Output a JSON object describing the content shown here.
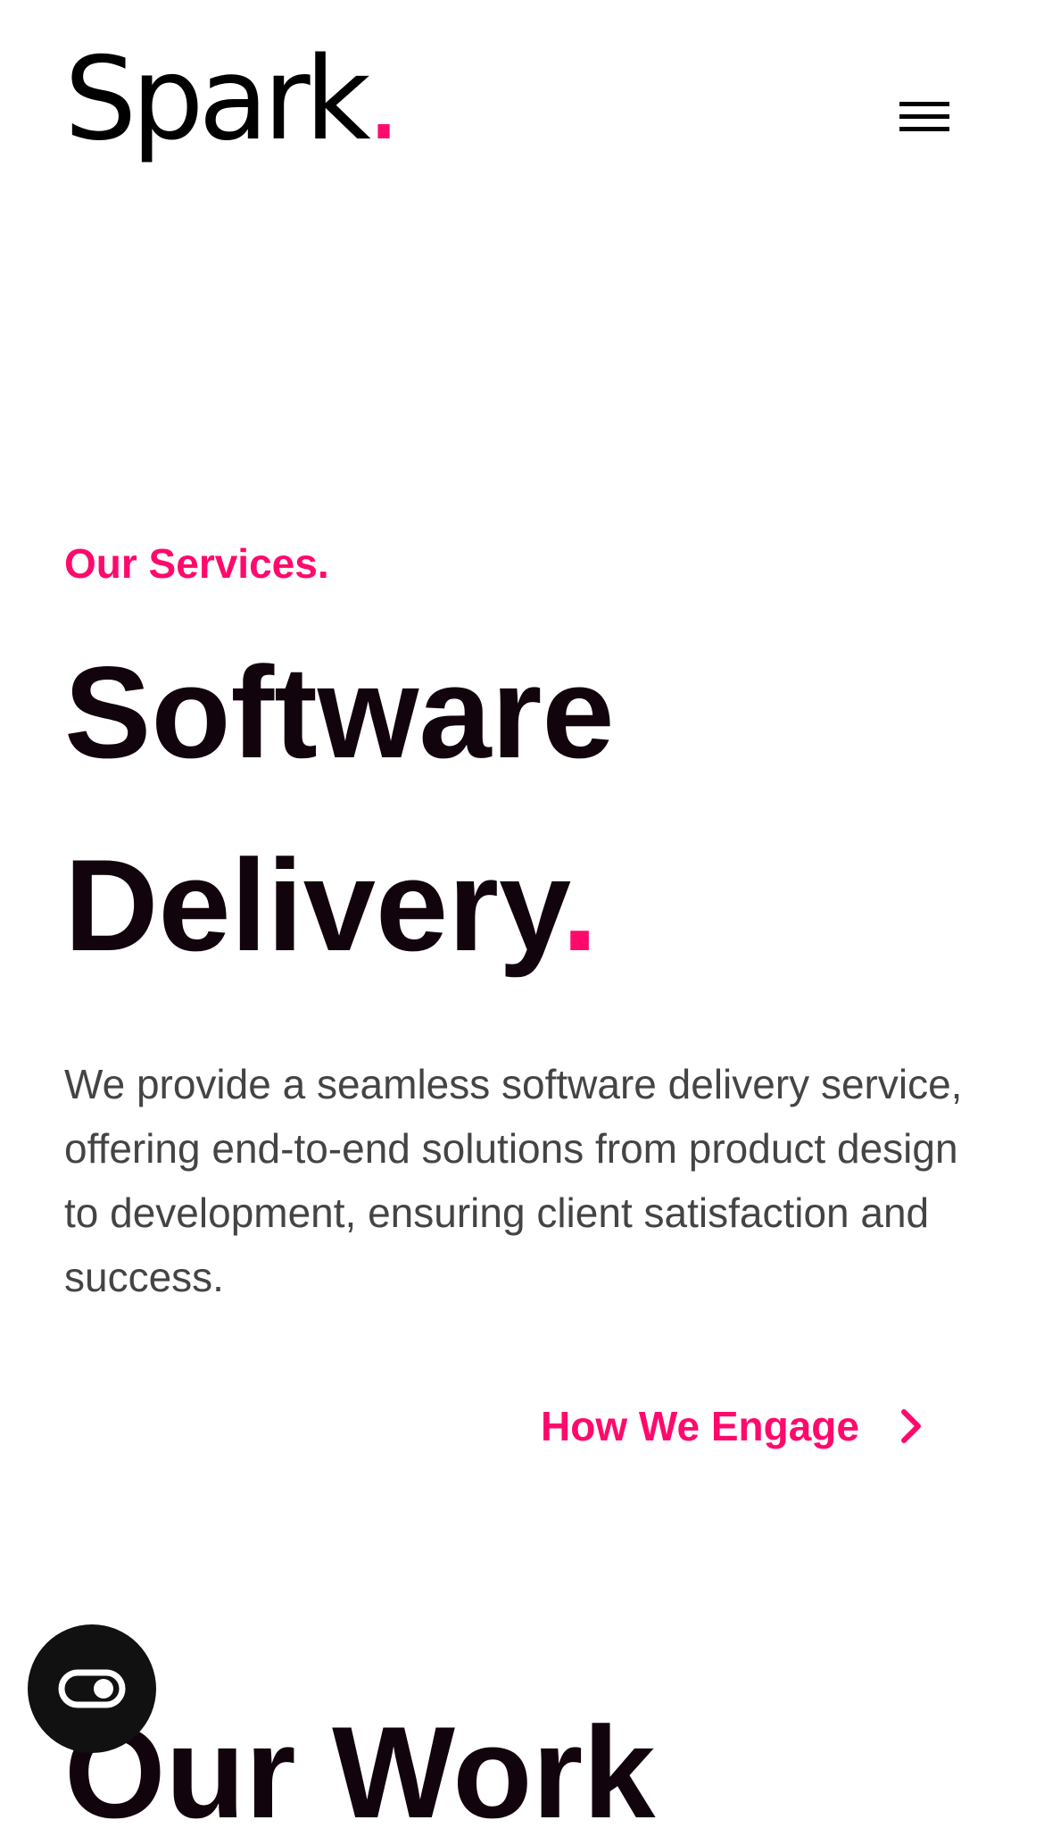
{
  "header": {
    "logo_text": "Spark",
    "logo_dot": ".",
    "menu_icon": "hamburger-menu-icon"
  },
  "hero": {
    "eyebrow": "Our Services.",
    "title_line1": "Software",
    "title_line2": "Delivery",
    "title_dot": ".",
    "description": "We provide a seamless software delivery service, offering end-to-end solutions from product design to development, ensuring client satisfaction and success.",
    "cta_label": "How We Engage",
    "cta_icon": "chevron-right-icon"
  },
  "next_section": {
    "title": "Our Work"
  },
  "widgets": {
    "accessibility_icon": "accessibility-toggle-icon"
  },
  "colors": {
    "accent": "#ff0a6c",
    "heading": "#12040c",
    "body_text": "#444444",
    "background": "#ffffff"
  }
}
